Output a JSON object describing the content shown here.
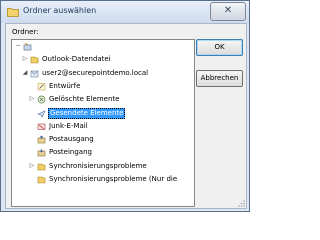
{
  "window": {
    "title": "Ordner auswählen",
    "close_glyph": "✕"
  },
  "labels": {
    "folder": "Ordner:"
  },
  "buttons": {
    "ok": "OK",
    "cancel": "Abbrechen"
  },
  "tree": [
    {
      "label": "",
      "indent": 0,
      "expander": "−",
      "icon": "root-icon"
    },
    {
      "label": "Outlook-Datendatei",
      "indent": 1,
      "expander": "▷",
      "icon": "data-file-icon"
    },
    {
      "label": "user2@securepointdemo.local",
      "indent": 1,
      "expander": "◢",
      "icon": "mailbox-icon"
    },
    {
      "label": "Entwürfe",
      "indent": 2,
      "expander": "",
      "icon": "drafts-icon"
    },
    {
      "label": "Gelöschte Elemente",
      "indent": 2,
      "expander": "▷",
      "icon": "deleted-items-icon"
    },
    {
      "label": "Gesendete Elemente",
      "indent": 2,
      "expander": "",
      "icon": "sent-items-icon",
      "selected": true
    },
    {
      "label": "Junk-E-Mail",
      "indent": 2,
      "expander": "",
      "icon": "junk-mail-icon"
    },
    {
      "label": "Postausgang",
      "indent": 2,
      "expander": "",
      "icon": "outbox-icon"
    },
    {
      "label": "Posteingang",
      "indent": 2,
      "expander": "",
      "icon": "inbox-icon"
    },
    {
      "label": "Synchronisierungsprobleme",
      "indent": 2,
      "expander": "▷",
      "icon": "sync-problems-icon"
    },
    {
      "label": "Synchronisierungsprobleme (Nur die",
      "indent": 2,
      "expander": "",
      "icon": "sync-problems-local-icon"
    }
  ]
}
